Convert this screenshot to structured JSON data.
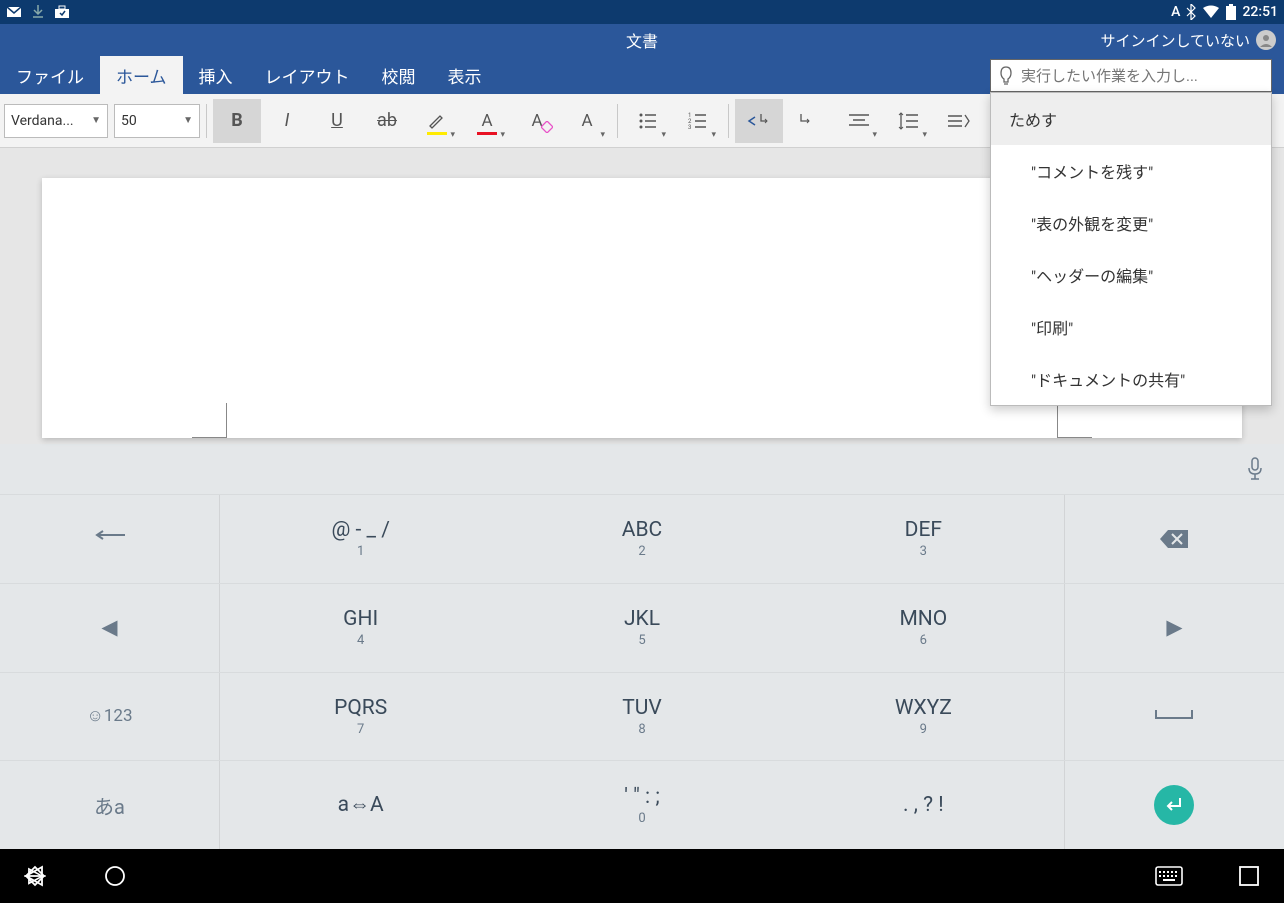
{
  "status": {
    "time": "22:51",
    "input_mode": "A"
  },
  "titlebar": {
    "doc_title": "文書",
    "signin": "サインインしていない"
  },
  "tabs": {
    "file": "ファイル",
    "home": "ホーム",
    "insert": "挿入",
    "layout": "レイアウト",
    "review": "校閲",
    "view": "表示"
  },
  "tellme": {
    "placeholder": "実行したい作業を入力し...",
    "try_label": "ためす",
    "items": [
      "\"コメントを残す\"",
      "\"表の外観を変更\"",
      "\"ヘッダーの編集\"",
      "\"印刷\"",
      "\"ドキュメントの共有\""
    ]
  },
  "toolbar": {
    "font_name": "Verdana...",
    "font_size": "50",
    "bold": "B",
    "italic": "I",
    "underline": "U",
    "strike": "ab",
    "font_color": "A",
    "clear_fmt": "A",
    "case": "A"
  },
  "keyboard": {
    "r1": {
      "k1": "@ - _ /",
      "s1": "1",
      "k2": "ABC",
      "s2": "2",
      "k3": "DEF",
      "s3": "3"
    },
    "r2": {
      "k1": "GHI",
      "s1": "4",
      "k2": "JKL",
      "s2": "5",
      "k3": "MNO",
      "s3": "6"
    },
    "r3": {
      "k1": "PQRS",
      "s1": "7",
      "k2": "TUV",
      "s2": "8",
      "k3": "WXYZ",
      "s3": "9",
      "side": "☺123"
    },
    "r4": {
      "side_l": "あa",
      "k1": "a⇔A",
      "k2": "' \" : ;",
      "s2": "0",
      "k3": ". , ? !"
    }
  }
}
